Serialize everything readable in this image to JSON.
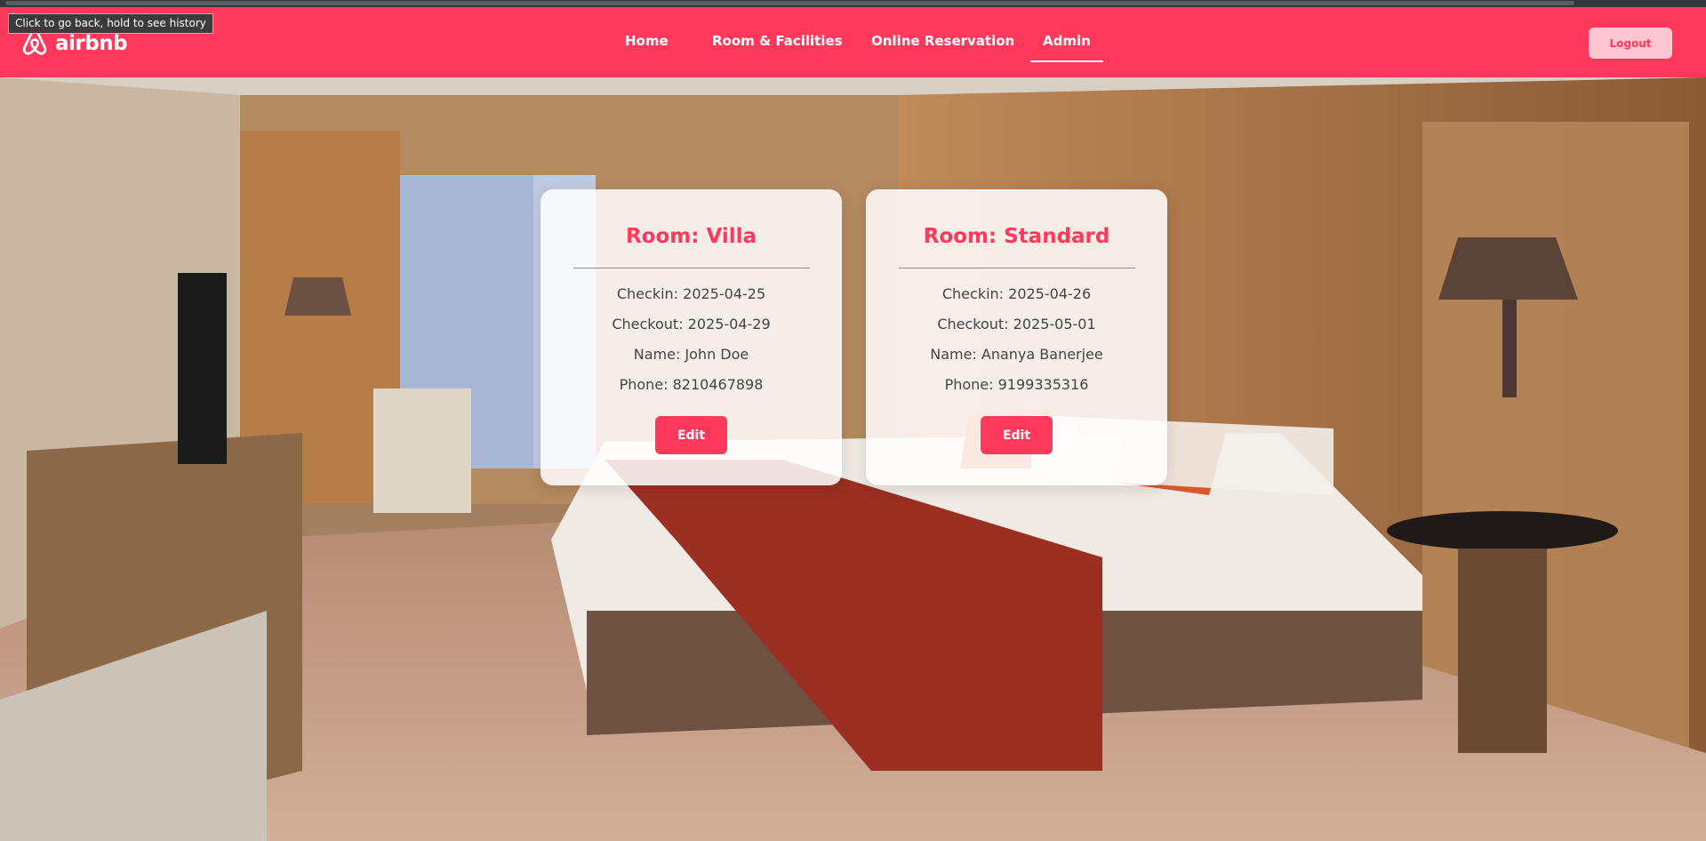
{
  "browser": {
    "tooltip": "Click to go back, hold to see history"
  },
  "navbar": {
    "logo_text": "airbnb",
    "links": [
      {
        "label": "Home",
        "active": false
      },
      {
        "label": "Room & Facilities",
        "active": false
      },
      {
        "label": "Online Reservation",
        "active": false
      },
      {
        "label": "Admin",
        "active": true
      }
    ],
    "logout_label": "Logout"
  },
  "bookings": [
    {
      "title": "Room: Villa",
      "checkin": "Checkin: 2025-04-25",
      "checkout": "Checkout: 2025-04-29",
      "name": "Name: John Doe",
      "phone": "Phone: 8210467898",
      "edit_label": "Edit"
    },
    {
      "title": "Room: Standard",
      "checkin": "Checkin: 2025-04-26",
      "checkout": "Checkout: 2025-05-01",
      "name": "Name: Ananya Banerjee",
      "phone": "Phone: 9199335316",
      "edit_label": "Edit"
    }
  ],
  "colors": {
    "brand": "#ff385c",
    "logout_bg": "#ffc5d0"
  },
  "icons": {
    "logo": "airbnb-logo-icon"
  }
}
